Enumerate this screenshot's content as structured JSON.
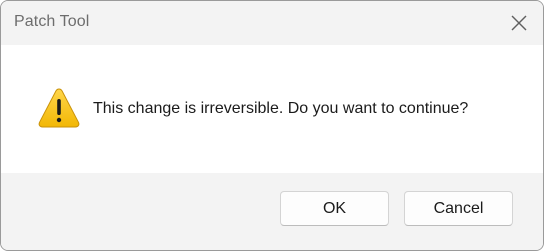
{
  "window": {
    "title": "Patch Tool",
    "close_icon": "close-icon"
  },
  "dialog": {
    "icon": "warning-icon",
    "message": "This change is irreversible. Do you want to continue?"
  },
  "buttons": {
    "ok_label": "OK",
    "cancel_label": "Cancel"
  },
  "colors": {
    "warning_fill": "#f7c325",
    "warning_glyph": "#000000",
    "chrome_bg": "#f3f3f3",
    "content_bg": "#ffffff"
  }
}
